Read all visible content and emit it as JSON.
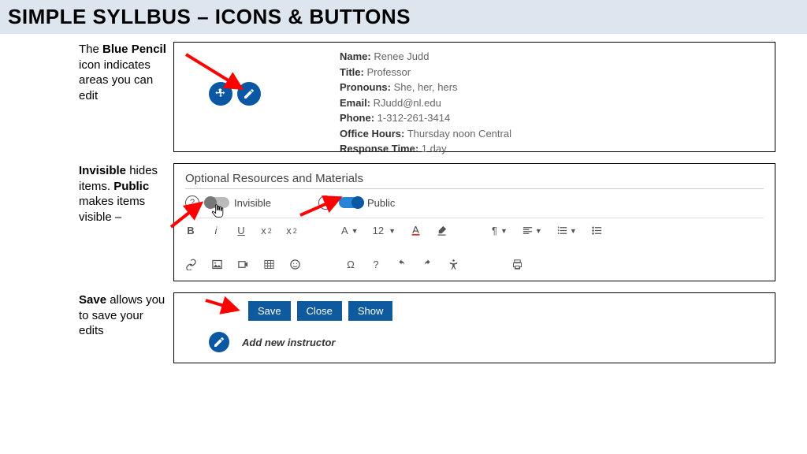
{
  "page_title": "SIMPLE SYLLBUS – ICONS & BUTTONS",
  "section1": {
    "desc_pre": "The ",
    "desc_bold": "Blue Pencil",
    "desc_post": " icon indicates areas you can edit",
    "fields": {
      "name_label": "Name:",
      "name_val": " Renee Judd",
      "title_label": "Title:",
      "title_val": " Professor",
      "pronouns_label": "Pronouns:",
      "pronouns_val": " She, her, hers",
      "email_label": "Email:",
      "email_val": " RJudd@nl.edu",
      "phone_label": "Phone:",
      "phone_val": " 1-312-261-3414",
      "office_label": "Office Hours:",
      "office_val": " Thursday noon Central",
      "response_label": "Response Time:",
      "response_val": " 1 day"
    }
  },
  "section2": {
    "desc_b1": "Invisible",
    "desc_p1": " hides items. ",
    "desc_b2": "Public",
    "desc_p2": " makes items visible –",
    "panel_title": "Optional Resources and Materials",
    "toggle1_label": "Invisible",
    "toggle2_label": "Public",
    "font_size": "12",
    "font_label": "A"
  },
  "section3": {
    "desc_b": "Save",
    "desc_p": " allows you to save your edits",
    "btn_save": "Save",
    "btn_close": "Close",
    "btn_show": "Show",
    "add_instructor": "Add new instructor"
  }
}
